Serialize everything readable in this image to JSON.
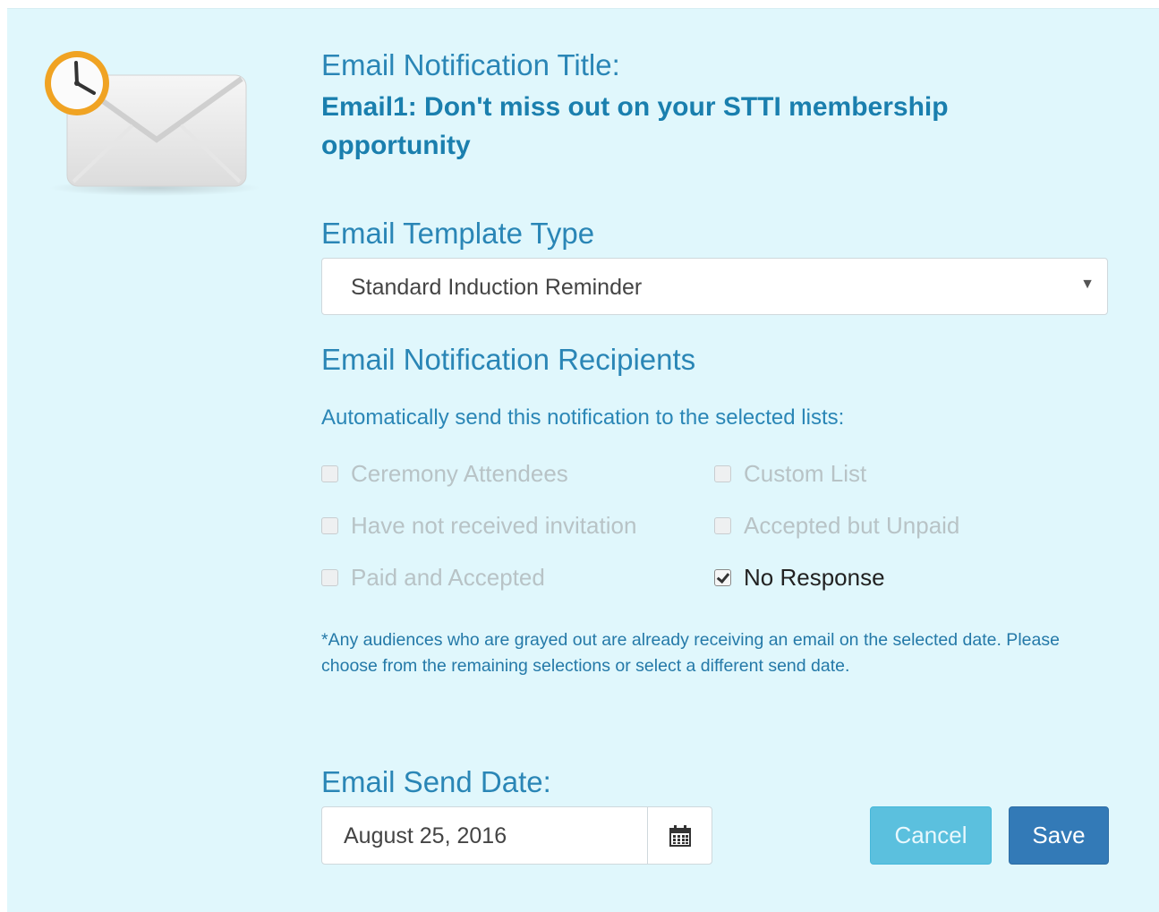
{
  "notification": {
    "title_label": "Email Notification Title:",
    "title_value": "Email1: Don't miss out on your STTI membership opportunity"
  },
  "template": {
    "label": "Email Template Type",
    "selected": "Standard Induction Reminder"
  },
  "recipients": {
    "label": "Email Notification Recipients",
    "instruction": "Automatically send this notification to the selected lists:",
    "options": [
      {
        "label": "Ceremony Attendees",
        "checked": false,
        "disabled": true
      },
      {
        "label": "Custom List",
        "checked": false,
        "disabled": true
      },
      {
        "label": "Have not received invitation",
        "checked": false,
        "disabled": true
      },
      {
        "label": "Accepted but Unpaid",
        "checked": false,
        "disabled": true
      },
      {
        "label": "Paid and Accepted",
        "checked": false,
        "disabled": true
      },
      {
        "label": "No Response",
        "checked": true,
        "disabled": false
      }
    ],
    "note": "*Any audiences who are grayed out are already receiving an email on the selected date. Please choose from the remaining selections or select a different send date."
  },
  "send_date": {
    "label": "Email Send Date:",
    "value": "August 25, 2016"
  },
  "actions": {
    "cancel_label": "Cancel",
    "save_label": "Save"
  },
  "colors": {
    "panel_bg": "#e0f7fc",
    "heading": "#2a86b6",
    "cancel_button": "#5bc0de",
    "save_button": "#337ab7"
  },
  "icons": {
    "main": "envelope-clock-icon",
    "date_addon": "calendar-icon",
    "select_caret": "caret-down-icon"
  }
}
